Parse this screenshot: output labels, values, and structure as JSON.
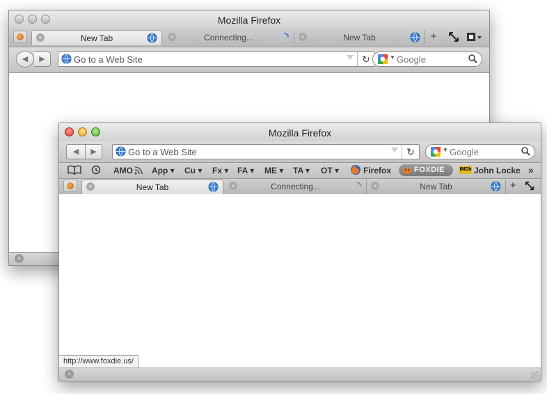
{
  "colors": {
    "globe": "#3d7fd0",
    "fox": "#d46b1f"
  },
  "back_window": {
    "title": "Mozilla Firefox",
    "tabs": [
      {
        "label": "New Tab",
        "active": true
      },
      {
        "label": "Connecting...",
        "active": false
      },
      {
        "label": "New Tab",
        "active": false
      }
    ],
    "new_tab_label": "+",
    "url_placeholder": "Go to a Web Site",
    "search_placeholder": "Google",
    "search_engine_icon": "google-icon"
  },
  "front_window": {
    "title": "Mozilla Firefox",
    "url_placeholder": "Go to a Web Site",
    "search_placeholder": "Google",
    "bookmarks": [
      {
        "label": "AMO"
      },
      {
        "label": "App ▾"
      },
      {
        "label": "Cu ▾"
      },
      {
        "label": "Fx ▾"
      },
      {
        "label": "FA ▾"
      },
      {
        "label": "ME ▾"
      },
      {
        "label": "TA ▾"
      },
      {
        "label": "OT ▾"
      },
      {
        "label": "Firefox"
      },
      {
        "label": "FOXDIE"
      },
      {
        "label": "John Locke"
      }
    ],
    "bookmarks_overflow": "»",
    "tabs": [
      {
        "label": "New Tab",
        "active": true
      },
      {
        "label": "Connecting...",
        "active": false
      },
      {
        "label": "New Tab",
        "active": false
      }
    ],
    "new_tab_label": "+",
    "imdb_badge": "IMDb",
    "status_link": "http://www.foxdie.us/"
  }
}
